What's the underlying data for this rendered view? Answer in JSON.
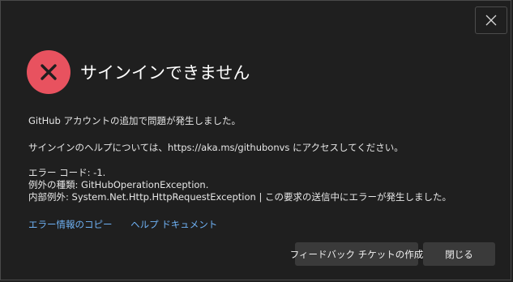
{
  "dialog": {
    "title": "サインインできません",
    "close_icon": "close-icon",
    "error_icon": "error-x-icon",
    "colors": {
      "error_accent": "#e8525f",
      "link": "#6fb2f5",
      "background": "#1f1f1f",
      "button": "#3a3a3a"
    },
    "message": "GitHub アカウントの追加で問題が発生しました。",
    "help_line": "サインインのヘルプについては、https://aka.ms/githubonvs にアクセスしてください。",
    "error_code": "エラー コード: -1.",
    "exception_type": "例外の種類: GitHubOperationException.",
    "inner_exception": "内部例外: System.Net.Http.HttpRequestException | この要求の送信中にエラーが発生しました。",
    "links": {
      "copy_error": "エラー情報のコピー",
      "help_docs": "ヘルプ ドキュメント"
    },
    "buttons": {
      "feedback": "フィードバック チケットの作成",
      "close": "閉じる"
    }
  }
}
